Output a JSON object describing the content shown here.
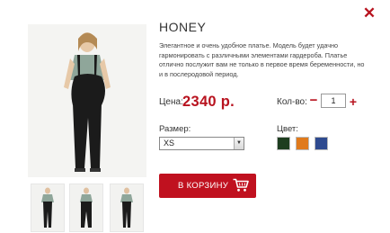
{
  "product": {
    "title": "HONEY",
    "description": "Элегантное и очень удобное платье. Модель будет удачно гармонировать с различными элементами гардероба. Платье отлично послужит вам не только в первое время беременности, но и в послеродовой период."
  },
  "price": {
    "label": "Цена:",
    "value": "2340 р."
  },
  "quantity": {
    "label": "Кол-во:",
    "value": "1",
    "minus": "−",
    "plus": "+"
  },
  "size": {
    "label": "Размер:",
    "selected": "XS"
  },
  "colors": {
    "label": "Цвет:",
    "options": [
      "#1d3d1f",
      "#e07a1c",
      "#2e4a8f"
    ]
  },
  "cart_button": {
    "label": "В КОРЗИНУ",
    "icon": "cart-icon"
  },
  "close": {
    "label": "✕",
    "icon": "close-icon"
  },
  "accent_color": "#c0111f"
}
